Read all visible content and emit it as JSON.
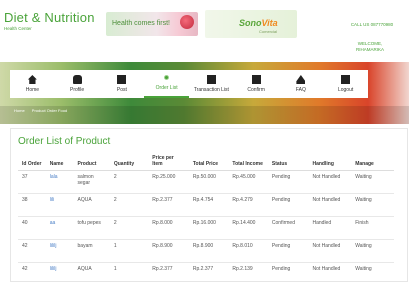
{
  "brand": {
    "title": "Diet & Nutrition",
    "subtitle": "Health Center"
  },
  "banners": {
    "health": "Health comes first!",
    "sonovita_logo_main": "Sono",
    "sonovita_logo_accent": "Vita",
    "sonovita_sub": "Comercial"
  },
  "call": "CALL US 087770980",
  "welcome": {
    "line1": "WELCOME,",
    "line2": "RIHAMARIKA"
  },
  "nav": {
    "items": [
      {
        "label": "Home",
        "icon": "home-icon"
      },
      {
        "label": "Profile",
        "icon": "profile-icon"
      },
      {
        "label": "Post",
        "icon": "post-icon"
      },
      {
        "label": "Order List",
        "icon": "order-list-icon",
        "active": true
      },
      {
        "label": "Transaction List",
        "icon": "transaction-list-icon"
      },
      {
        "label": "Confirm",
        "icon": "confirm-icon"
      },
      {
        "label": "FAQ",
        "icon": "faq-icon"
      },
      {
        "label": "Logout",
        "icon": "logout-icon"
      }
    ]
  },
  "breadcrumb": {
    "home": "Home",
    "current": "Product Order Food"
  },
  "page": {
    "title": "Order List of Product"
  },
  "table": {
    "headers": [
      "Id Order",
      "Name",
      "Product",
      "Quantity",
      "Price per Item",
      "Total Price",
      "Total Income",
      "Status",
      "Handling",
      "Manage"
    ],
    "rows": [
      [
        "37",
        "lala",
        "salmon segar",
        "2",
        "Rp.25.000",
        "Rp.50.000",
        "Rp.45.000",
        "Pending",
        "Not Handled",
        "Waiting"
      ],
      [
        "38",
        "lili",
        "AQUA",
        "2",
        "Rp.2.377",
        "Rp.4.754",
        "Rp.4.279",
        "Pending",
        "Not Handled",
        "Waiting"
      ],
      [
        "40",
        "aa",
        "tofu pepes",
        "2",
        "Rp.8.000",
        "Rp.16.000",
        "Rp.14.400",
        "Confirmed",
        "Handled",
        "Finish"
      ],
      [
        "42",
        "lililj",
        "bayam",
        "1",
        "Rp.8.900",
        "Rp.8.900",
        "Rp.8.010",
        "Pending",
        "Not Handled",
        "Waiting"
      ],
      [
        "42",
        "lililj",
        "AQUA",
        "1",
        "Rp.2.377",
        "Rp.2.377",
        "Rp.2.139",
        "Pending",
        "Not Handled",
        "Waiting"
      ]
    ]
  },
  "colors": {
    "brand_green": "#4aa33a",
    "link_blue": "#4a7fc6"
  }
}
